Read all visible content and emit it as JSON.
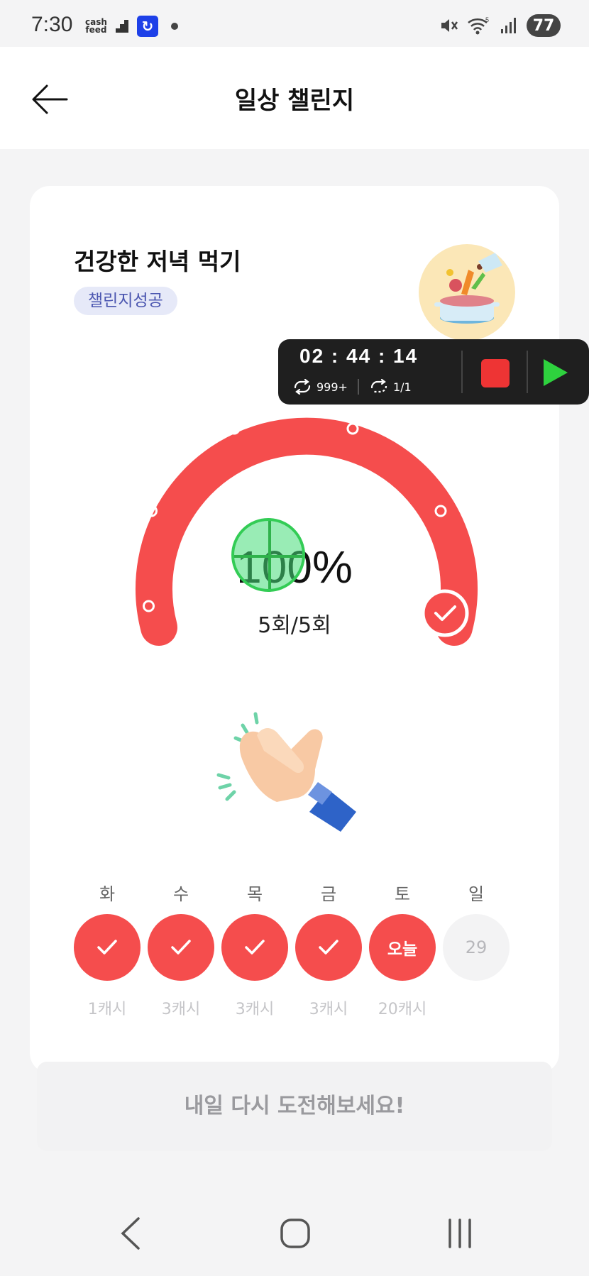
{
  "status_bar": {
    "time": "7:30",
    "app_label": "cash\nfeed",
    "battery": "77"
  },
  "header": {
    "title": "일상 챌린지"
  },
  "challenge": {
    "title": "건강한 저녁 먹기",
    "status_badge": "챌린지성공",
    "progress_percent": "100%",
    "progress_fraction": 1.0,
    "count_label": "5회/5회",
    "accent_color": "#f54d4d"
  },
  "week": [
    {
      "day": "화",
      "state": "done",
      "text": "",
      "reward": "1캐시"
    },
    {
      "day": "수",
      "state": "done",
      "text": "",
      "reward": "3캐시"
    },
    {
      "day": "목",
      "state": "done",
      "text": "",
      "reward": "3캐시"
    },
    {
      "day": "금",
      "state": "done",
      "text": "",
      "reward": "3캐시"
    },
    {
      "day": "토",
      "state": "today",
      "text": "오늘",
      "reward": "20캐시"
    },
    {
      "day": "일",
      "state": "future",
      "text": "29",
      "reward": ""
    }
  ],
  "retry_button": "내일 다시 도전해보세요!",
  "recorder": {
    "time": "02 : 44 : 14",
    "loops": "999+",
    "repeat": "1/1"
  },
  "nav": {
    "icons": [
      "back-nav-icon",
      "home-nav-icon",
      "recents-nav-icon"
    ]
  }
}
